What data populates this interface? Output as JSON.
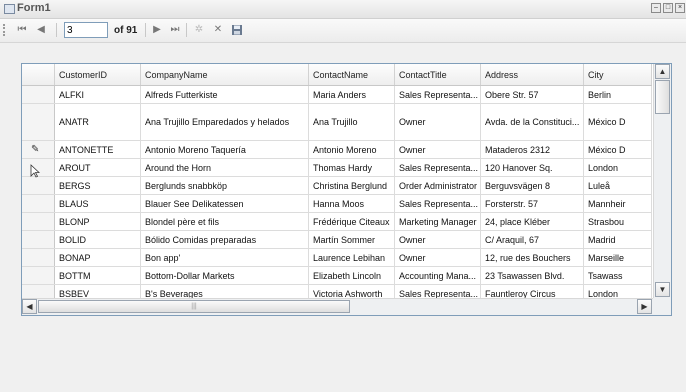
{
  "window": {
    "title": "Form1"
  },
  "toolbar": {
    "position_value": "3",
    "of_label": "of 91",
    "icons": [
      "move-first-icon",
      "move-previous-icon",
      "move-next-icon",
      "move-last-icon",
      "add-new-icon",
      "delete-icon",
      "save-icon"
    ]
  },
  "grid": {
    "columns": [
      "CustomerID",
      "CompanyName",
      "ContactName",
      "ContactTitle",
      "Address",
      "City"
    ],
    "editing_row_index": 2,
    "rows": [
      [
        "ALFKI",
        "Alfreds Futterkiste",
        "Maria Anders",
        "Sales Representa...",
        "Obere Str. 57",
        "Berlin"
      ],
      [
        "ANATR",
        "Ana Trujillo Emparedados y helados",
        "Ana Trujillo",
        "Owner",
        "Avda. de la Constituci...",
        "México D"
      ],
      [
        "ANTONETTE",
        "Antonio Moreno Taquería",
        "Antonio Moreno",
        "Owner",
        "Mataderos  2312",
        "México D"
      ],
      [
        "AROUT",
        "Around the Horn",
        "Thomas Hardy",
        "Sales Representa...",
        "120 Hanover Sq.",
        "London"
      ],
      [
        "BERGS",
        "Berglunds snabbköp",
        "Christina Berglund",
        "Order Administrator",
        "Berguvsvägen  8",
        "Luleå"
      ],
      [
        "BLAUS",
        "Blauer See Delikatessen",
        "Hanna Moos",
        "Sales Representa...",
        "Forsterstr. 57",
        "Mannheir"
      ],
      [
        "BLONP",
        "Blondel père et fils",
        "Frédérique Citeaux",
        "Marketing Manager",
        "24, place Kléber",
        "Strasbou"
      ],
      [
        "BOLID",
        "Bólido Comidas preparadas",
        "Martín Sommer",
        "Owner",
        "C/ Araquil, 67",
        "Madrid"
      ],
      [
        "BONAP",
        "Bon app'",
        "Laurence Lebihan",
        "Owner",
        "12, rue des Bouchers",
        "Marseille"
      ],
      [
        "BOTTM",
        "Bottom-Dollar Markets",
        "Elizabeth Lincoln",
        "Accounting Mana...",
        "23 Tsawassen Blvd.",
        "Tsawass"
      ],
      [
        "BSBEV",
        "B's Beverages",
        "Victoria Ashworth",
        "Sales Representa...",
        "Fauntleroy Circus",
        "London"
      ]
    ]
  }
}
